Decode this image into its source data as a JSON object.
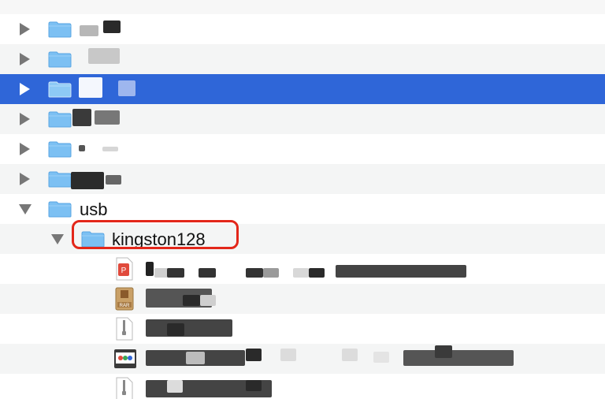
{
  "colors": {
    "selection": "#2f66d8",
    "folder_blue": "#7cc0f3",
    "annotation_red": "#e3271a"
  },
  "tree": {
    "folders": [
      {
        "label": "",
        "expanded": false,
        "selected": false
      },
      {
        "label": "",
        "expanded": false,
        "selected": false
      },
      {
        "label": "",
        "expanded": false,
        "selected": true
      },
      {
        "label": "",
        "expanded": false,
        "selected": false
      },
      {
        "label": "",
        "expanded": false,
        "selected": false
      },
      {
        "label": "",
        "expanded": false,
        "selected": false
      },
      {
        "label": "usb",
        "expanded": true,
        "selected": false
      }
    ],
    "subfolder": {
      "label": "kingston128",
      "expanded": true
    },
    "files": [
      {
        "label": "",
        "icon": "pdf-file-icon"
      },
      {
        "label": "",
        "icon": "rar-archive-icon"
      },
      {
        "label": "",
        "icon": "zip-file-icon"
      },
      {
        "label": "",
        "icon": "video-file-icon"
      },
      {
        "label": "",
        "icon": "zip-file-icon"
      }
    ]
  }
}
